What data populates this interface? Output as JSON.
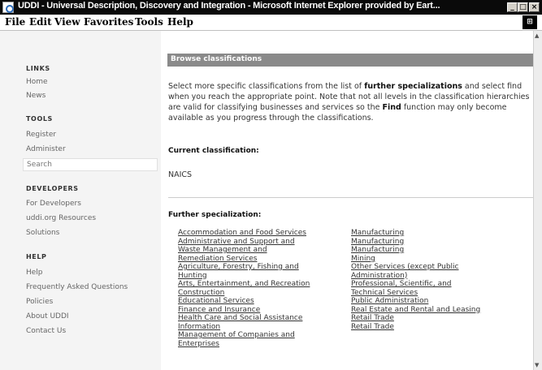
{
  "window": {
    "title": "UDDI - Universal Description, Discovery and Integration - Microsoft Internet Explorer provided by Eart...",
    "minimize_glyph": "_",
    "maximize_glyph": "□",
    "close_glyph": "×"
  },
  "menu": [
    "File",
    "Edit",
    "View",
    "Favorites",
    "Tools",
    "Help"
  ],
  "sidebar": {
    "links_heading": "LINKS",
    "links": [
      "Home",
      "News"
    ],
    "tools_heading": "TOOLS",
    "tools": [
      "Register",
      "Administer",
      "Search"
    ],
    "developers_heading": "DEVELOPERS",
    "developers": [
      "For Developers",
      "uddi.org Resources",
      "Solutions"
    ],
    "help_heading": "HELP",
    "help": [
      "Help",
      "Frequently Asked Questions",
      "Policies",
      "About UDDI",
      "Contact Us"
    ]
  },
  "main": {
    "band_title": "Browse classifications",
    "intro": {
      "p1": "Select more specific classifications from the list of ",
      "b1": "further specializations",
      "p2": " and select find when you reach the appropriate point. Note that not all levels in the classification hierarchies are valid for classifying businesses and services so the ",
      "b2": "Find",
      "p3": " function may only become available as you progress through the classifications."
    },
    "current_label": "Current classification:",
    "current_value": "NAICS",
    "further_label": "Further specialization:",
    "col1": [
      "Accommodation and Food Services",
      "Administrative and Support and",
      "Waste Management and",
      "Remediation Services",
      "Agriculture, Forestry, Fishing and",
      "Hunting",
      "Arts, Entertainment, and Recreation",
      "Construction",
      "Educational Services",
      "Finance and Insurance",
      "Health Care and Social Assistance",
      "Information",
      "Management of Companies and",
      "Enterprises"
    ],
    "col2": [
      "Manufacturing",
      "Manufacturing",
      "Manufacturing",
      "Mining",
      "Other Services (except Public",
      "Administration)",
      "Professional, Scientific, and",
      "Technical Services",
      "Public Administration",
      "Real Estate and Rental and Leasing",
      "Retail Trade",
      "Retail Trade"
    ]
  },
  "scrollbar": {
    "up": "▲",
    "down": "▼"
  }
}
